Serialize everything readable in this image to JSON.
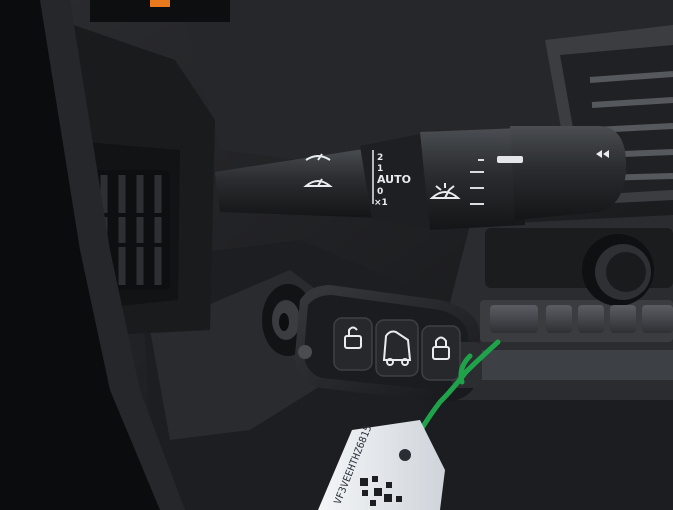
{
  "photo": {
    "subject": "car-interior",
    "colors": {
      "dashboard": "#1f2022",
      "plastic_light": "#4a4d52",
      "stalk": "#2c2e31",
      "stalk_markings": "#e9ecef",
      "key_fob": "#232427",
      "zip_tie": "#1fa34a",
      "tag": "#e6e9ee",
      "display_glow": "#e8791d"
    }
  },
  "wiper_stalk": {
    "positions": [
      "2",
      "1",
      "AUTO",
      "0",
      "×1"
    ],
    "icons": [
      "windshield-wiper-icon",
      "rear-wiper-icon",
      "washer-icon"
    ]
  },
  "key_fob": {
    "buttons": [
      "unlock-button",
      "trunk-button",
      "lock-button"
    ],
    "icons": [
      "padlock-open-icon",
      "van-door-icon",
      "padlock-closed-icon"
    ]
  },
  "tag": {
    "text": "VF3VEEHTHZ6815"
  }
}
